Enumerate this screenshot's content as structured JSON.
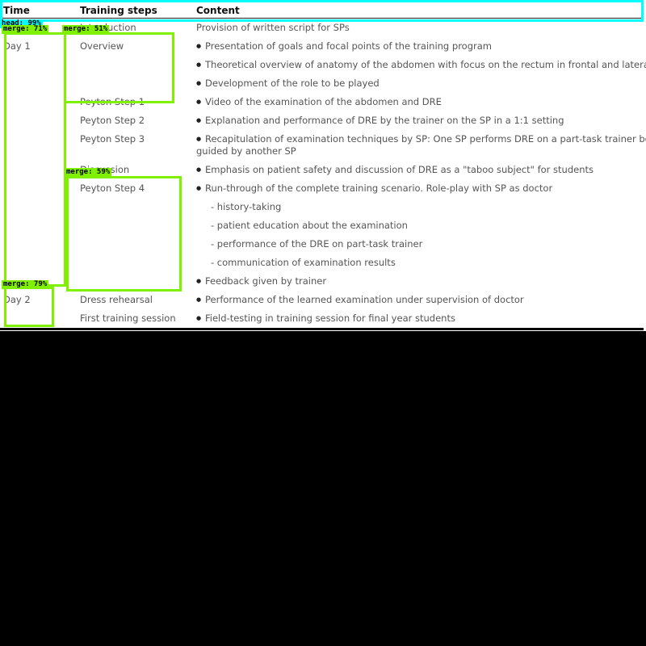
{
  "colors": {
    "head": "#00ffff",
    "merge": "#7ff000",
    "background": "#000000"
  },
  "table": {
    "headers": {
      "time": "Time",
      "steps": "Training steps",
      "content": "Content"
    },
    "rows": [
      {
        "step": "Introduction",
        "content": "Provision of written script for SPs"
      },
      {
        "time": "Day 1",
        "step": "Overview",
        "content": "Presentation of goals and focal points of the training program"
      },
      {
        "content": "Theoretical overview of anatomy of the abdomen with focus on the rectum in frontal and lateral view"
      },
      {
        "content": "Development of the role to be played"
      },
      {
        "step": "Peyton Step 1",
        "content": "Video of the examination of the abdomen and DRE"
      },
      {
        "step": "Peyton Step 2",
        "content": "Explanation and performance of DRE by the trainer on the SP in a 1:1 setting"
      },
      {
        "step": "Peyton Step 3",
        "content": "Recapitulation of examination techniques by SP: One SP performs DRE on a part-task trainer being",
        "content2": "guided by another SP"
      },
      {
        "step": "Discussion",
        "content": "Emphasis on patient safety and discussion of DRE as a \"taboo subject\" for students"
      },
      {
        "step": "Peyton Step 4",
        "content": "Run-through of the complete training scenario. Role-play with SP as doctor"
      },
      {
        "content": "- history-taking"
      },
      {
        "content": "- patient education about the examination"
      },
      {
        "content": "- performance of the DRE on part-task trainer"
      },
      {
        "content": "- communication of examination results"
      },
      {
        "content": "Feedback given by trainer"
      },
      {
        "time": "Day 2",
        "step": "Dress rehearsal",
        "content": "Performance of the learned examination under supervision of doctor"
      },
      {
        "step": "First training session",
        "content": "Field-testing in training session for final year students"
      }
    ]
  },
  "detections": {
    "head": "head: 99%",
    "merge_day1": "merge: 71%",
    "merge_overview": "merge: 51%",
    "merge_step4": "merge: 59%",
    "merge_day2": "merge: 79%"
  }
}
